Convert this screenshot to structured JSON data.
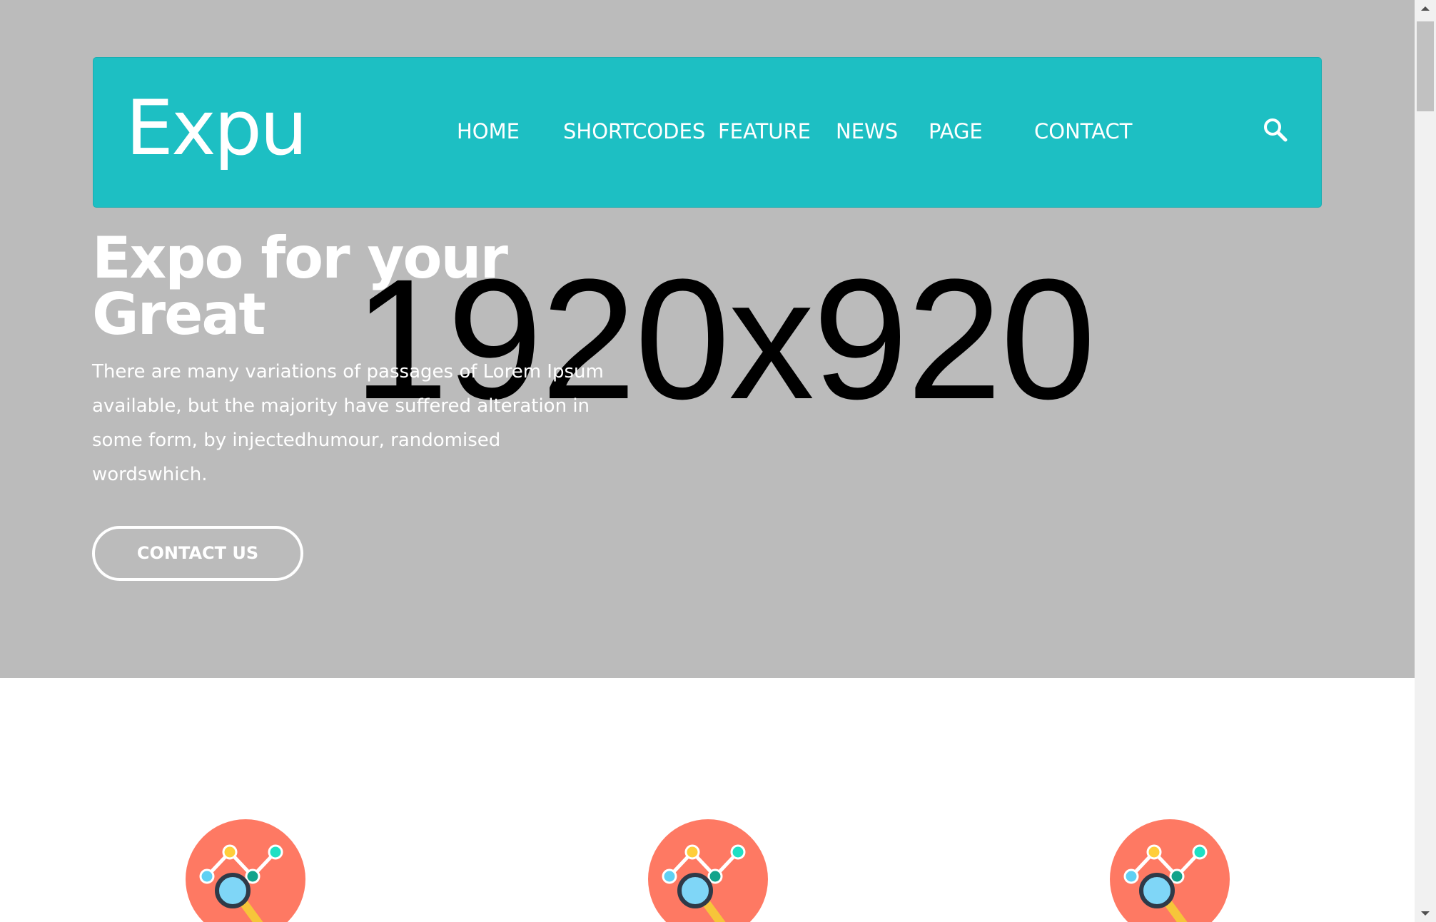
{
  "header": {
    "logo": "Expu",
    "nav": [
      "HOME",
      "SHORTCODES",
      "FEATURE",
      "NEWS",
      "PAGE",
      "CONTACT"
    ],
    "search_icon": "search-icon"
  },
  "hero": {
    "placeholder_label": "1920x920",
    "title": "Expo for your Great",
    "description": "There are many variations of passages of Lorem Ipsum available, but the majority have suffered alteration in some form, by injectedhumour, randomised wordswhich.",
    "cta_label": "CONTACT US"
  },
  "features": {
    "icons": [
      "analytics-icon",
      "analytics-icon",
      "analytics-icon"
    ]
  },
  "colors": {
    "navbar": "#1dbfc3",
    "hero_background": "#bbbbbb",
    "feature_circle": "#fe7963"
  }
}
